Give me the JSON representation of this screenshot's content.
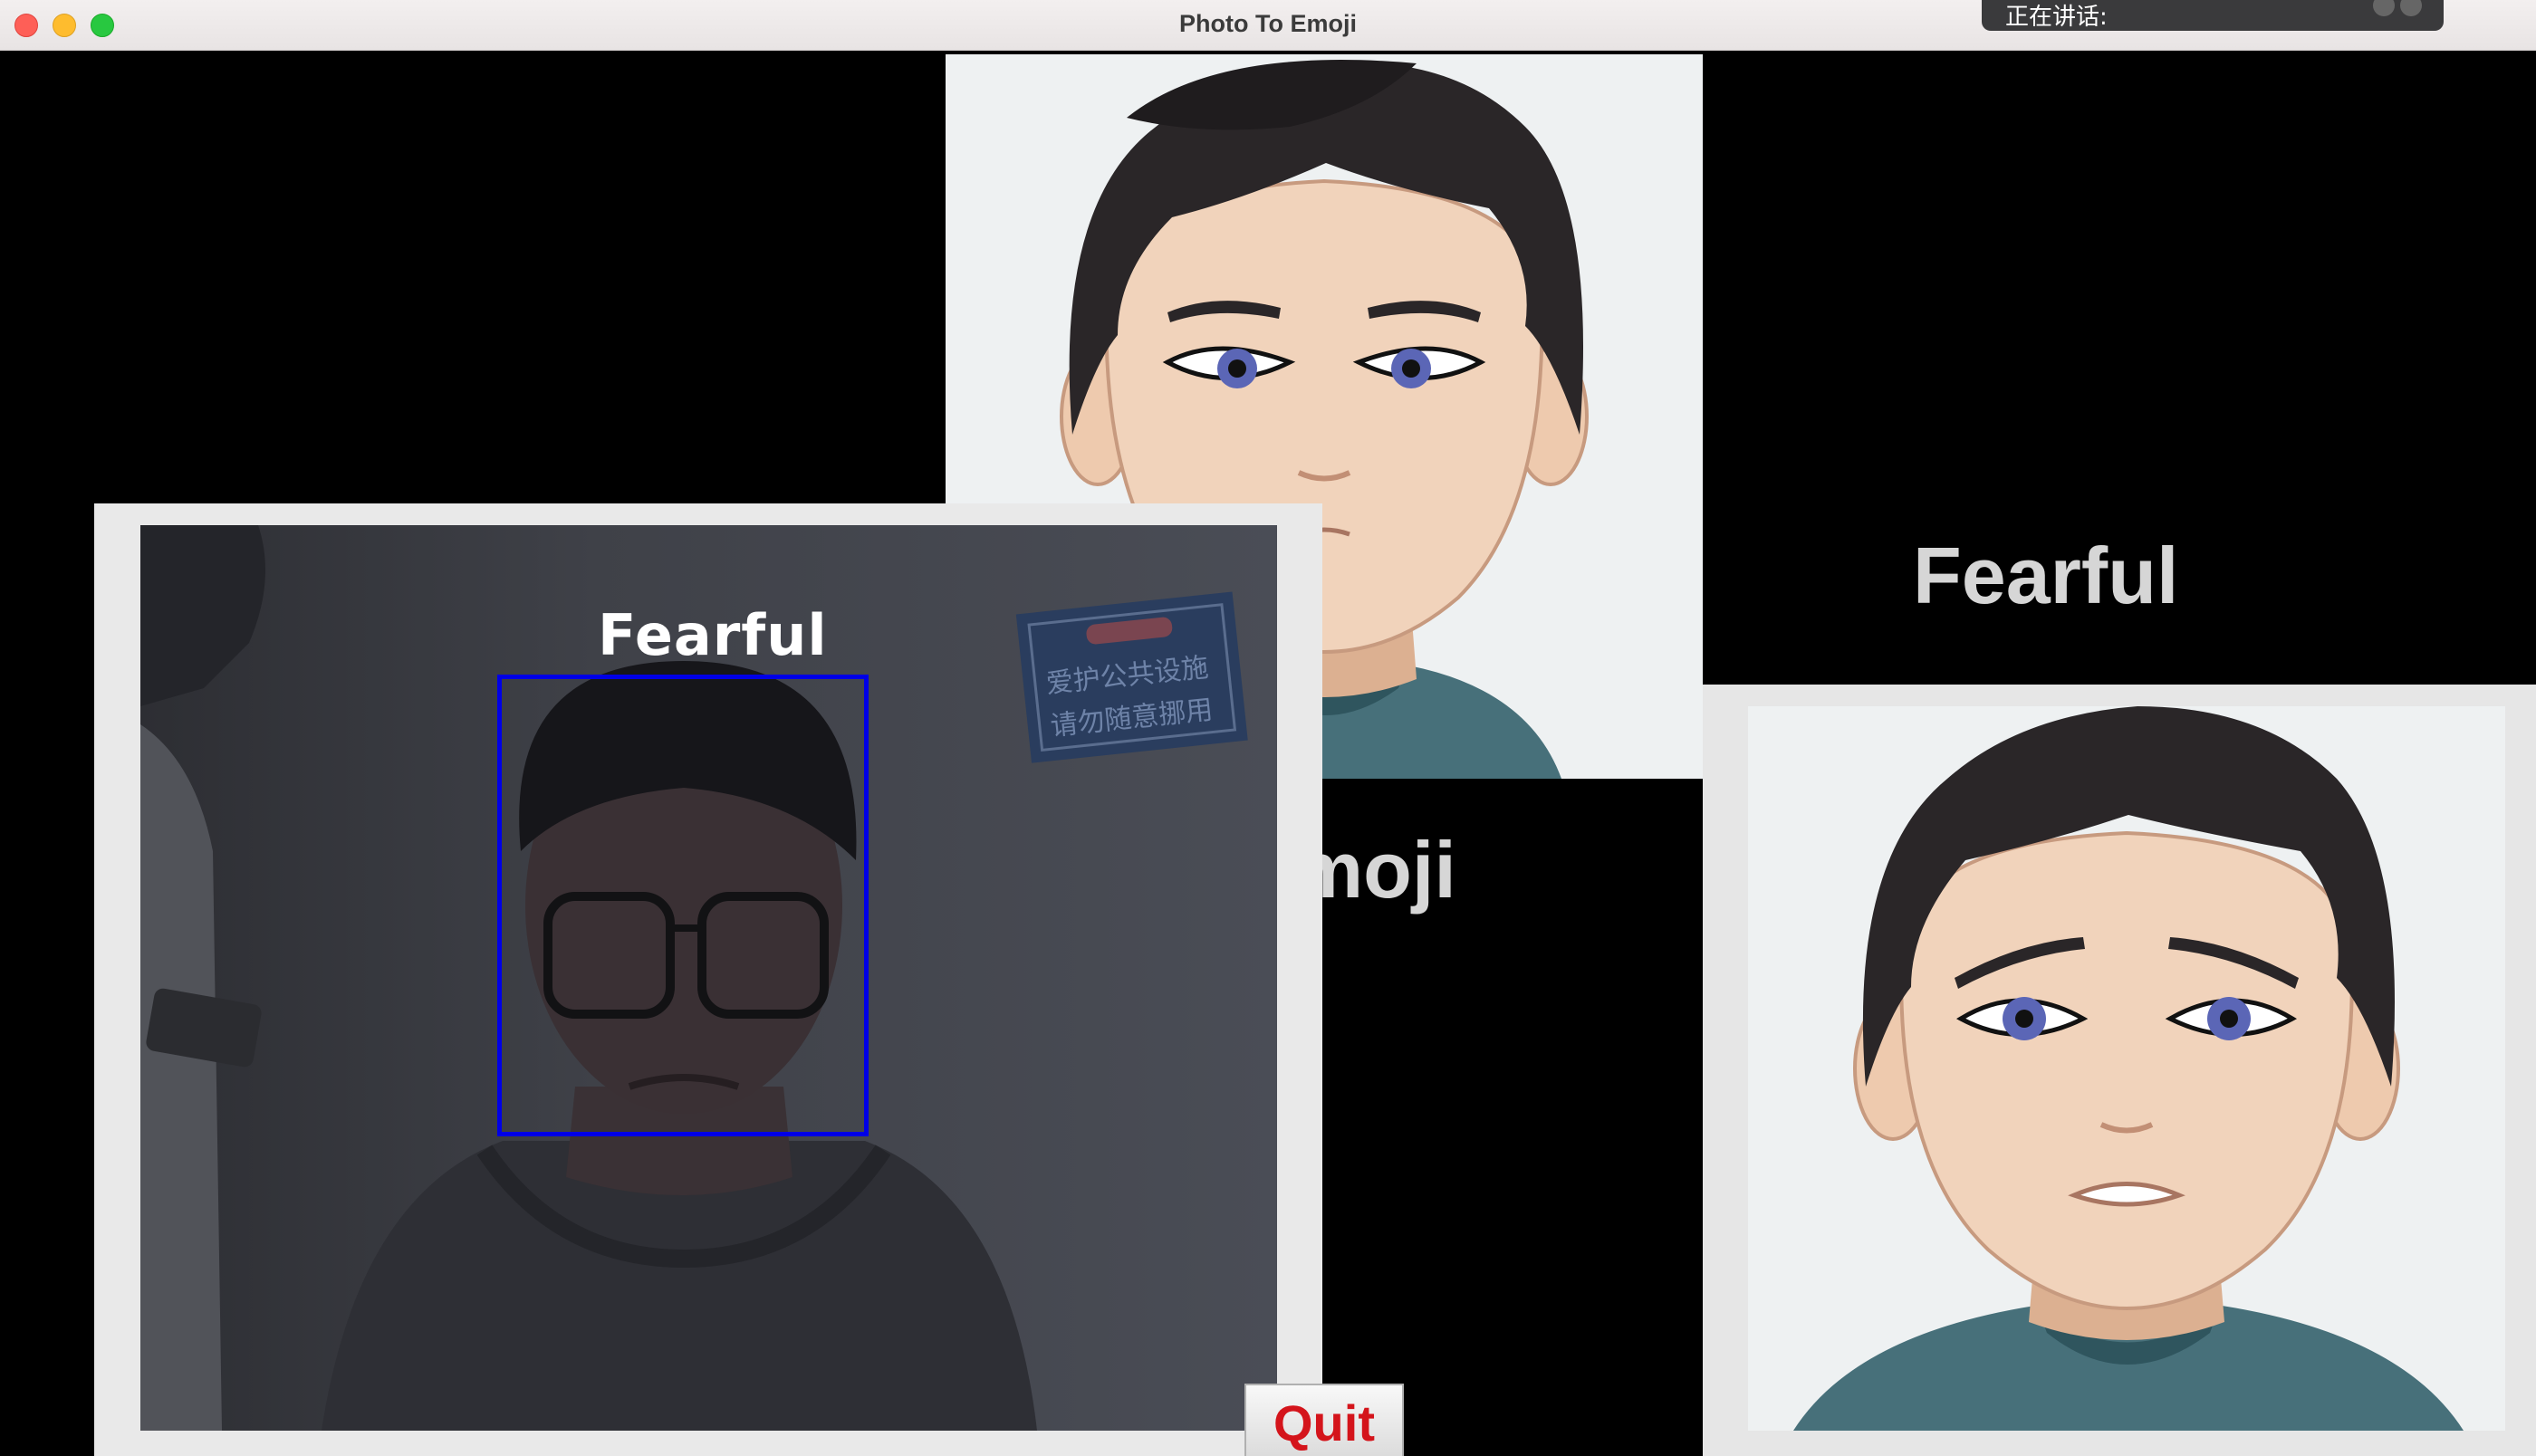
{
  "window": {
    "title": "Photo To Emoji",
    "controls": [
      "close",
      "minimize",
      "maximize"
    ]
  },
  "overlay": {
    "speaking_text": "正在讲话:"
  },
  "main": {
    "emotion_label": "Fearful",
    "app_title_visible": "o Emoji"
  },
  "camera": {
    "detection_label": "Fearful",
    "sign_text_line1": "爱护公共设施",
    "sign_text_line2": "请勿随意挪用"
  },
  "quit": {
    "label": "Quit"
  },
  "colors": {
    "face_box": "#0000e6",
    "quit_text": "#d4141b",
    "label_text": "#d6d6d6"
  },
  "icons": {
    "avatar_neutral": "avatar-neutral-icon",
    "avatar_fearful": "avatar-fearful-icon"
  }
}
